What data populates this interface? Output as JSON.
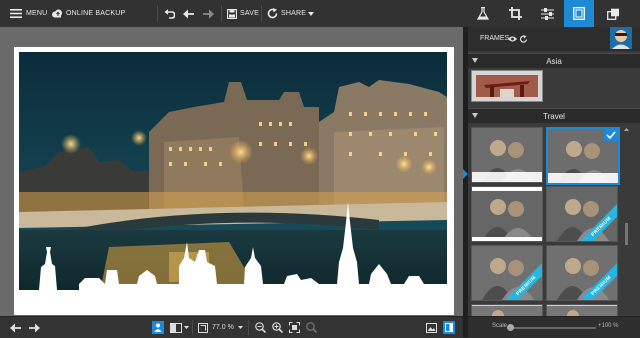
{
  "topbar": {
    "menu_label": "MENU",
    "backup_label": "ONLINE BACKUP",
    "save_label": "SAVE",
    "share_label": "SHARE"
  },
  "tool_tabs": [
    {
      "name": "effects-tab",
      "icon": "flask-icon"
    },
    {
      "name": "crop-tab",
      "icon": "crop-icon"
    },
    {
      "name": "adjust-tab",
      "icon": "sliders-icon"
    },
    {
      "name": "frames-tab",
      "icon": "frame-icon",
      "active": true
    },
    {
      "name": "layers-tab",
      "icon": "layers-icon"
    }
  ],
  "panel": {
    "title": "FRAMES",
    "sections": [
      {
        "label": "Asia"
      },
      {
        "label": "Travel"
      }
    ],
    "premium_label": "PREMIUM",
    "scale": {
      "label": "Scale",
      "value": "+100 %"
    }
  },
  "bottombar": {
    "zoom": "77.0 %"
  },
  "colors": {
    "accent": "#1e8ad6",
    "ribbon": "#27b5e0",
    "panel_bg": "#3a3a3a"
  }
}
